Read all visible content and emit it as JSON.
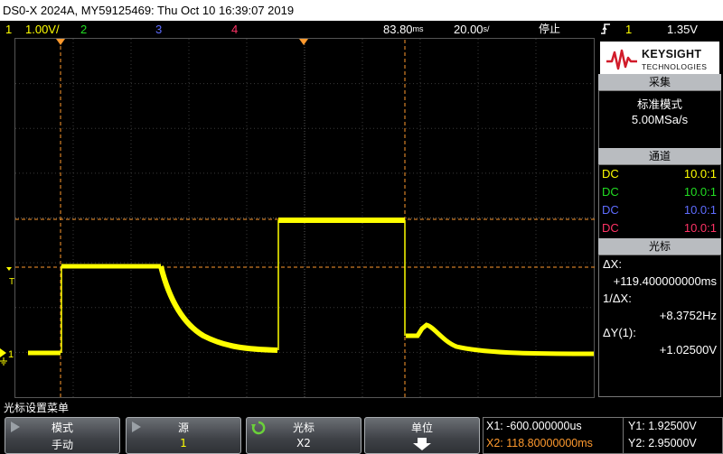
{
  "titlebar": {
    "text": "DS0-X 2024A, MY59125469: Thu Oct 10 16:39:07 2019"
  },
  "status": {
    "ch1_num": "1",
    "ch1_scale": "1.00V/",
    "ch2_num": "2",
    "ch3_num": "3",
    "ch4_num": "4",
    "time_offset": "83.80",
    "time_offset_unit": "ms",
    "timebase": "20.00",
    "timebase_unit": "s/",
    "run_state": "停止",
    "trigger_edge_icon": "rising-edge-icon",
    "trigger_source": "1",
    "trigger_level": "1.35V"
  },
  "scope": {
    "ground_marker": "1",
    "trigger_marker": "T",
    "colors": {
      "ch1": "#ffff00",
      "cursor": "#ff9a2e",
      "grid": "#444444",
      "grid_dots": "#666666"
    }
  },
  "panel": {
    "logo": {
      "brand": "KEYSIGHT",
      "sub": "TECHNOLOGIES"
    },
    "acquire": {
      "title": "采集",
      "mode": "标准模式",
      "rate": "5.00MSa/s"
    },
    "channels": {
      "title": "通道",
      "rows": [
        {
          "coupling": "DC",
          "probe": "10.0:1",
          "color": "#ffff00"
        },
        {
          "coupling": "DC",
          "probe": "10.0:1",
          "color": "#22dd22"
        },
        {
          "coupling": "DC",
          "probe": "10.0:1",
          "color": "#5e6cff"
        },
        {
          "coupling": "DC",
          "probe": "10.0:1",
          "color": "#ff3366"
        }
      ]
    },
    "cursors": {
      "title": "光标",
      "dx_label": "ΔX:",
      "dx_value": "+119.400000000ms",
      "inv_dx_label": "1/ΔX:",
      "inv_dx_value": "+8.3752Hz",
      "dy_label": "ΔY(1):",
      "dy_value": "+1.02500V"
    }
  },
  "menu": {
    "title": "光标设置菜单"
  },
  "softkeys": [
    {
      "label": "模式",
      "value": "手动"
    },
    {
      "label": "源",
      "value": "1"
    },
    {
      "label": "光标",
      "value": "X2"
    },
    {
      "label": "单位",
      "value": ""
    }
  ],
  "cursorinfo": {
    "x1": "X1: -600.000000us",
    "x2": "X2: 118.80000000ms",
    "y1": "Y1: 1.92500V",
    "y2": "Y2: 2.95000V"
  }
}
